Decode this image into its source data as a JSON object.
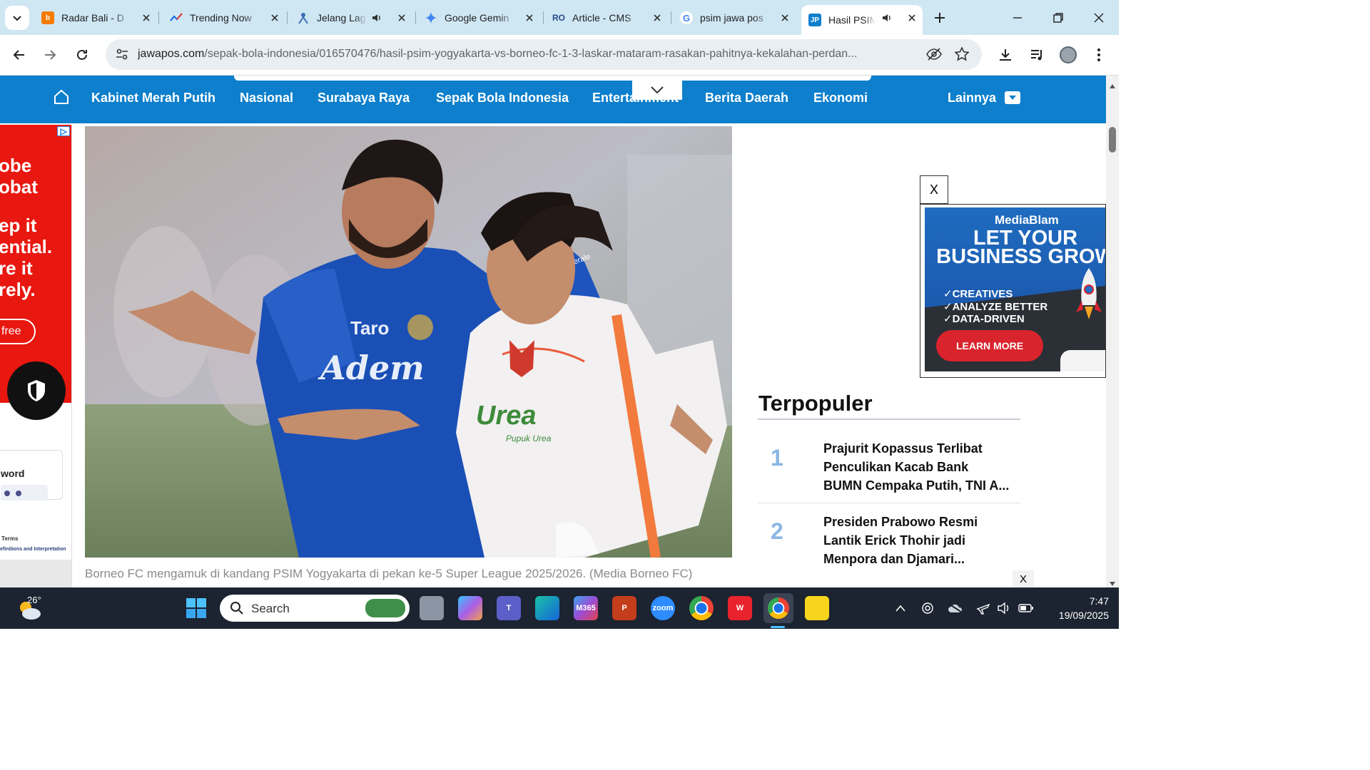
{
  "browser": {
    "tabs": [
      {
        "label": "Radar Bali - D",
        "favicon": "radar-bali-icon",
        "color": "#f57c00",
        "glyph": "b",
        "audio": false
      },
      {
        "label": "Trending Now",
        "favicon": "trends-icon",
        "color": "#1a73e8",
        "glyph": "",
        "audio": false
      },
      {
        "label": "Jelang Lag",
        "favicon": "jelang-icon",
        "color": "#3b6db3",
        "glyph": "",
        "audio": true
      },
      {
        "label": "Google Gemin",
        "favicon": "gemini-icon",
        "color": "#4285f4",
        "glyph": "",
        "audio": false
      },
      {
        "label": "Article - CMS",
        "favicon": "cms-icon",
        "color": "#274b8c",
        "glyph": "RO",
        "audio": false
      },
      {
        "label": "psim jawa pos",
        "favicon": "google-icon",
        "color": "#ffffff",
        "glyph": "G",
        "audio": false
      },
      {
        "label": "Hasil PSIM",
        "favicon": "jawapos-icon",
        "color": "#0d7fcc",
        "glyph": "JP",
        "audio": true,
        "active": true
      }
    ],
    "url_domain": "jawapos.com",
    "url_path": "/sepak-bola-indonesia/016570476/hasil-psim-yogyakarta-vs-borneo-fc-1-3-laskar-mataram-rasakan-pahitnya-kekalahan-perdan..."
  },
  "site_nav": {
    "items": [
      "Kabinet Merah Putih",
      "Nasional",
      "Surabaya Raya",
      "Sepak Bola Indonesia",
      "Entertainment",
      "Berita Daerah",
      "Ekonomi"
    ],
    "more_label": "Lainnya",
    "accent": "#0d7fcc"
  },
  "left_ad": {
    "lines_top": "obe\nobat",
    "lines_mid": "ep it\nential.\nre it\nrely.",
    "button": "free",
    "form_label": "word",
    "terms": "Terms",
    "terms_sub": "efinitions and Interpretation",
    "accent": "#e8170f"
  },
  "article": {
    "caption": "Borneo FC mengamuk di kandang PSIM Yogyakarta di pekan ke-5 Super League 2025/2026. (Media Borneo FC)",
    "jersey_blue_text": "Adem",
    "jersey_sponsor": "Taro",
    "jersey_white_text": "Urea",
    "jersey_white_sub": "Pupuk Urea",
    "sleeve_text": "Le Minerale"
  },
  "right_ad": {
    "close_label": "X",
    "brand": "MediaBlam",
    "headline": "LET YOUR BUSINESS GROW",
    "bullets": [
      "✓CREATIVES",
      "✓ANALYZE BETTER",
      "✓DATA-DRIVEN"
    ],
    "cta": "LEARN MORE"
  },
  "popular": {
    "title": "Terpopuler",
    "items": [
      {
        "rank": "1",
        "title": "Prajurit Kopassus Terlibat Penculikan Kacab Bank BUMN Cempaka Putih, TNI A..."
      },
      {
        "rank": "2",
        "title": "Presiden Prabowo Resmi Lantik Erick Thohir jadi Menpora dan Djamari..."
      }
    ]
  },
  "bottom_close": "X",
  "taskbar": {
    "weather_temp": "26°",
    "search_placeholder": "Search",
    "time": "7:47",
    "date": "19/09/2025"
  }
}
